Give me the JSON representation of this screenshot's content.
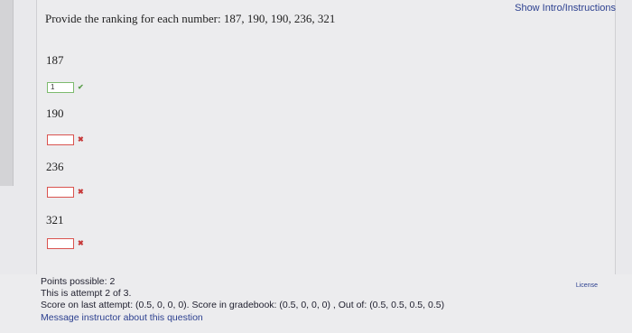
{
  "header": {
    "show_intro_label": "Show Intro/Instructions"
  },
  "question": {
    "prompt": "Provide the ranking for each number:  187, 190, 190, 236, 321",
    "items": [
      {
        "number": "187",
        "answer": "1",
        "status": "correct"
      },
      {
        "number": "190",
        "answer": "",
        "status": "incorrect"
      },
      {
        "number": "236",
        "answer": "",
        "status": "incorrect"
      },
      {
        "number": "321",
        "answer": "",
        "status": "incorrect"
      }
    ]
  },
  "footer": {
    "points_possible": "Points possible: 2",
    "attempt": "This is attempt 2 of 3.",
    "score": "Score on last attempt: (0.5, 0, 0, 0). Score in gradebook: (0.5, 0, 0, 0) , Out of: (0.5, 0.5, 0.5, 0.5)",
    "message_instructor": "Message instructor about this question",
    "license": "License"
  },
  "colors": {
    "link": "#2b3f8f",
    "correct": "#5a9e4a",
    "incorrect": "#c73a3a"
  },
  "icons": {
    "correct": "checkmark-icon",
    "incorrect": "x-mark-icon"
  }
}
